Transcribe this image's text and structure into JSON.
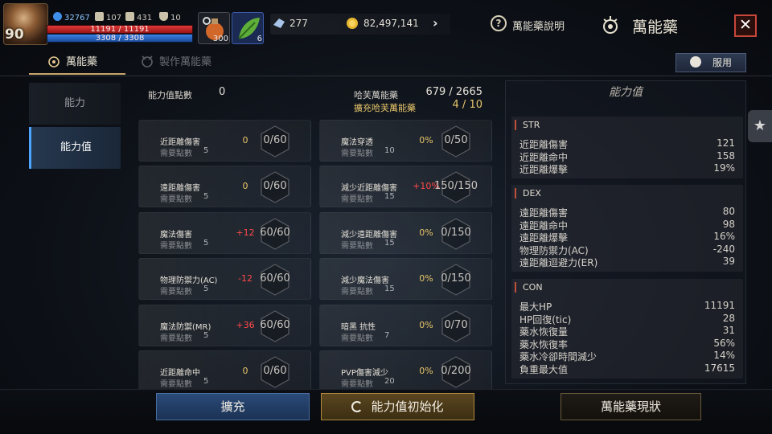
{
  "header": {
    "level": "90",
    "stat_a": "32767",
    "stat_b": "107",
    "stat_c": "431",
    "stat_d": "10",
    "hp_text": "11191 / 11191",
    "mp_text": "3308 / 3308",
    "item1_count": "300",
    "item2_count": "6",
    "currency1": "277",
    "currency2": "82,497,141",
    "help_label": "萬能藥說明",
    "title": "萬能藥",
    "close_glyph": "✕"
  },
  "tabs": [
    {
      "label": "萬能藥"
    },
    {
      "label": "製作萬能藥"
    }
  ],
  "use_button": "服用",
  "nav": [
    {
      "label": "能力"
    },
    {
      "label": "能力值"
    }
  ],
  "summary": {
    "points_label": "能力值點數",
    "points_value": "0",
    "capacity_label": "哈芙萬能藥",
    "capacity_value": "679 / 2665",
    "expand_label": "擴充哈芙萬能藥",
    "expand_value": "4 / 10"
  },
  "cards_left": [
    {
      "name": "近距離傷害",
      "req_label": "需要點數",
      "req": "5",
      "bonus": "0",
      "progress": "0/60"
    },
    {
      "name": "遠距離傷害",
      "req_label": "需要點數",
      "req": "5",
      "bonus": "0",
      "progress": "0/60"
    },
    {
      "name": "魔法傷害",
      "req_label": "需要點數",
      "req": "5",
      "bonus": "+12",
      "progress": "60/60"
    },
    {
      "name": "物理防禦力(AC)",
      "req_label": "需要點數",
      "req": "5",
      "bonus": "-12",
      "progress": "60/60"
    },
    {
      "name": "魔法防禦(MR)",
      "req_label": "需要點數",
      "req": "5",
      "bonus": "+36",
      "progress": "60/60"
    },
    {
      "name": "近距離命中",
      "req_label": "需要點數",
      "req": "5",
      "bonus": "0",
      "progress": "0/60"
    }
  ],
  "cards_right": [
    {
      "name": "魔法穿透",
      "req_label": "需要點數",
      "req": "10",
      "bonus": "0%",
      "progress": "0/50"
    },
    {
      "name": "減少近距離傷害",
      "req_label": "需要點數",
      "req": "15",
      "bonus": "+10%",
      "progress": "150/150"
    },
    {
      "name": "減少遠距離傷害",
      "req_label": "需要點數",
      "req": "15",
      "bonus": "0%",
      "progress": "0/150"
    },
    {
      "name": "減少魔法傷害",
      "req_label": "需要點數",
      "req": "15",
      "bonus": "0%",
      "progress": "0/150"
    },
    {
      "name": "暗黑 抗性",
      "req_label": "需要點數",
      "req": "7",
      "bonus": "0%",
      "progress": "0/70"
    },
    {
      "name": "PVP傷害減少",
      "req_label": "需要點數",
      "req": "20",
      "bonus": "0%",
      "progress": "0/200"
    }
  ],
  "stats_panel": {
    "title": "能力值",
    "sections": [
      {
        "name": "STR",
        "rows": [
          {
            "label": "近距離傷害",
            "value": "121"
          },
          {
            "label": "近距離命中",
            "value": "158"
          },
          {
            "label": "近距離爆擊",
            "value": "19%"
          }
        ]
      },
      {
        "name": "DEX",
        "rows": [
          {
            "label": "遠距離傷害",
            "value": "80"
          },
          {
            "label": "遠距離命中",
            "value": "98"
          },
          {
            "label": "遠距離爆擊",
            "value": "16%"
          },
          {
            "label": "物理防禦力(AC)",
            "value": "-240"
          },
          {
            "label": "遠距離迴避力(ER)",
            "value": "39"
          }
        ]
      },
      {
        "name": "CON",
        "rows": [
          {
            "label": "最大HP",
            "value": "11191"
          },
          {
            "label": "HP回復(tic)",
            "value": "28"
          },
          {
            "label": "藥水恢復量",
            "value": "31"
          },
          {
            "label": "藥水恢復率",
            "value": "56%"
          },
          {
            "label": "藥水冷卻時間減少",
            "value": "14%"
          },
          {
            "label": "負重最大值",
            "value": "17615"
          }
        ]
      }
    ]
  },
  "bottom": {
    "expand": "擴充",
    "reset": "能力值初始化",
    "status": "萬能藥現狀"
  },
  "colors": {
    "positive": "#ff4a4a",
    "highlight": "#e8c56a",
    "accent_blue": "#4aa6ff"
  }
}
